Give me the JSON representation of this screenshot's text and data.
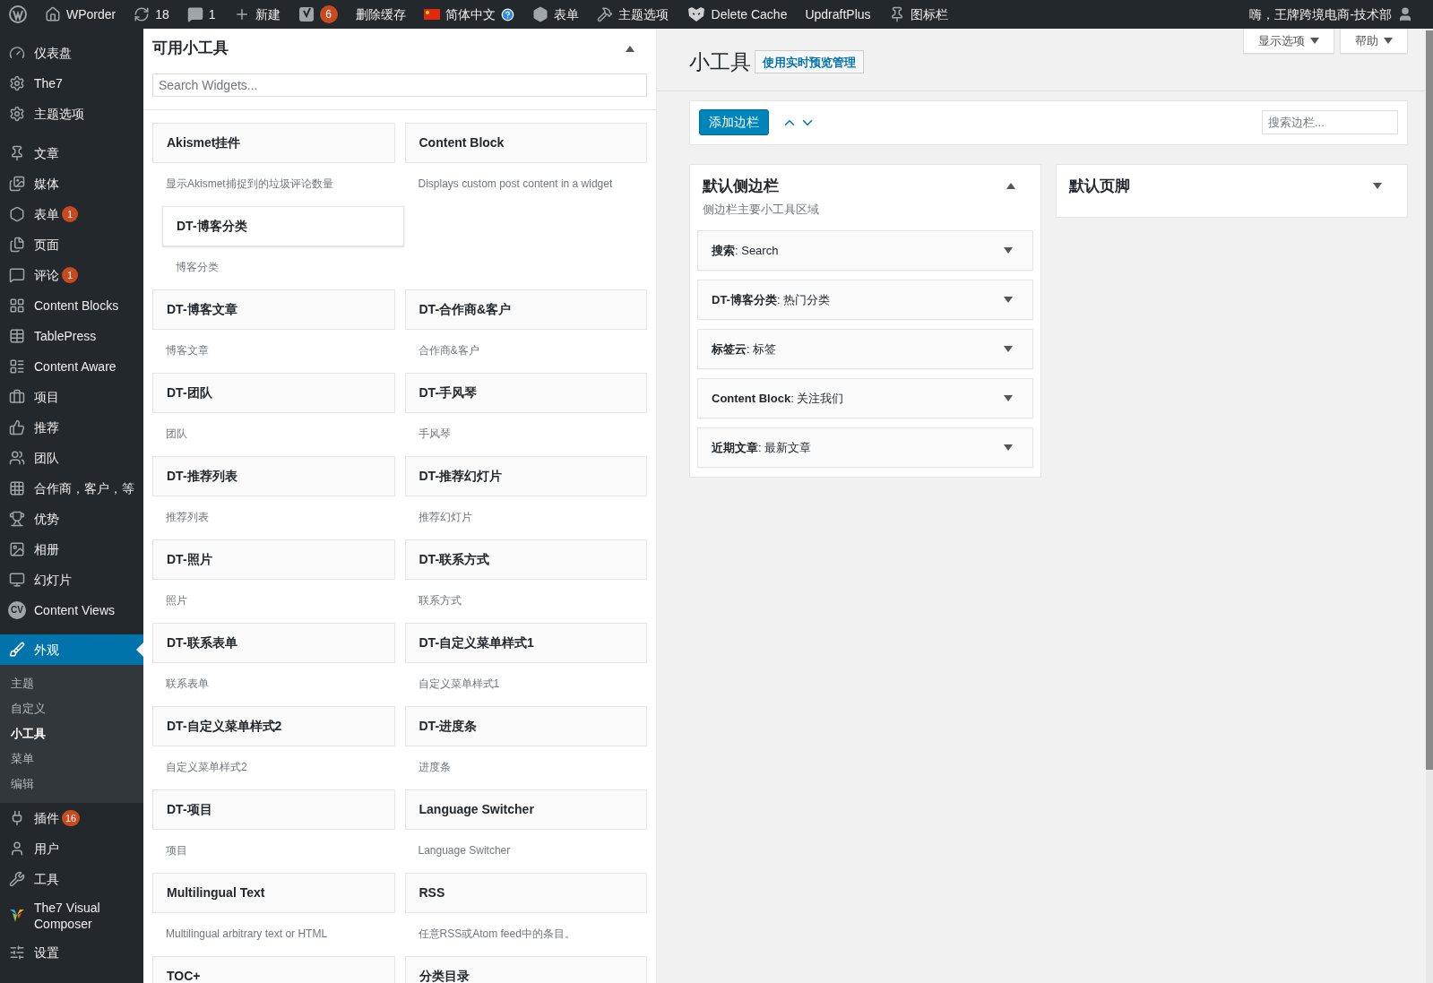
{
  "admin_bar": {
    "left": [
      {
        "label": "WPorder"
      },
      {
        "label": "18"
      },
      {
        "label": "1"
      },
      {
        "label": "新建"
      },
      {
        "badge": "6"
      },
      {
        "label": "删除缓存"
      },
      {
        "label": "简体中文"
      },
      {
        "label": "表单"
      },
      {
        "label": "主题选项"
      },
      {
        "label": "Delete Cache"
      },
      {
        "label": "UpdraftPlus"
      },
      {
        "label": "图标栏"
      }
    ],
    "greeting": "嗨，王牌跨境电商-技术部"
  },
  "sidebar": {
    "groups": [
      [
        {
          "label": "仪表盘",
          "selected": false
        },
        {
          "label": "The7",
          "selected": false
        },
        {
          "label": "主题选项",
          "selected": false
        }
      ],
      [
        {
          "label": "文章",
          "selected": false
        },
        {
          "label": "媒体",
          "selected": false
        },
        {
          "label": "表单",
          "badge": "1",
          "selected": false
        },
        {
          "label": "页面",
          "selected": false
        },
        {
          "label": "评论",
          "badge": "1",
          "selected": false
        },
        {
          "label": "Content Blocks",
          "selected": false
        },
        {
          "label": "TablePress",
          "selected": false
        },
        {
          "label": "Content Aware",
          "selected": false
        },
        {
          "label": "项目",
          "selected": false
        },
        {
          "label": "推荐",
          "selected": false
        },
        {
          "label": "团队",
          "selected": false
        },
        {
          "label": "合作商，客户，等",
          "selected": false
        },
        {
          "label": "优势",
          "selected": false
        },
        {
          "label": "相册",
          "selected": false
        },
        {
          "label": "幻灯片",
          "selected": false
        },
        {
          "label": "Content Views",
          "icon_text": "CV",
          "selected": false
        }
      ],
      [
        {
          "label": "外观",
          "selected": true,
          "children": [
            {
              "label": "主题",
              "selected": false
            },
            {
              "label": "自定义",
              "selected": false
            },
            {
              "label": "小工具",
              "selected": true
            },
            {
              "label": "菜单",
              "selected": false
            },
            {
              "label": "编辑",
              "selected": false
            }
          ]
        },
        {
          "label": "插件",
          "badge": "16",
          "selected": false
        },
        {
          "label": "用户",
          "selected": false
        },
        {
          "label": "工具",
          "selected": false
        },
        {
          "label": "The7 Visual Composer",
          "selected": false
        },
        {
          "label": "设置",
          "selected": false
        }
      ]
    ]
  },
  "available_widgets": {
    "title": "可用小工具",
    "expanded": true,
    "search": {
      "placeholder": "Search Widgets..."
    },
    "widgets": [
      {
        "name": "Akismet挂件",
        "description": "显示Akismet捕捉到的垃圾评论数量",
        "dragging": false
      },
      {
        "name": "Content Block",
        "description": "Displays custom post content in a widget",
        "dragging": false
      },
      {
        "name": "DT-博客分类",
        "description": "博客分类",
        "dragging": true
      },
      {
        "name": "DT-博客文章",
        "description": "博客文章",
        "dragging": false
      },
      {
        "name": "DT-合作商&客户",
        "description": "合作商&客户",
        "dragging": false
      },
      {
        "name": "DT-团队",
        "description": "团队",
        "dragging": false
      },
      {
        "name": "DT-手风琴",
        "description": "手风琴",
        "dragging": false
      },
      {
        "name": "DT-推荐列表",
        "description": "推荐列表",
        "dragging": false
      },
      {
        "name": "DT-推荐幻灯片",
        "description": "推荐幻灯片",
        "dragging": false
      },
      {
        "name": "DT-照片",
        "description": "照片",
        "dragging": false
      },
      {
        "name": "DT-联系方式",
        "description": "联系方式",
        "dragging": false
      },
      {
        "name": "DT-联系表单",
        "description": "联系表单",
        "dragging": false
      },
      {
        "name": "DT-自定义菜单样式1",
        "description": "自定义菜单样式1",
        "dragging": false
      },
      {
        "name": "DT-自定义菜单样式2",
        "description": "自定义菜单样式2",
        "dragging": false
      },
      {
        "name": "DT-进度条",
        "description": "进度条",
        "dragging": false
      },
      {
        "name": "DT-项目",
        "description": "项目",
        "dragging": false
      },
      {
        "name": "Language Switcher",
        "description": "Language Switcher",
        "dragging": false
      },
      {
        "name": "Multilingual Text",
        "description": "Multilingual arbitrary text or HTML",
        "dragging": false
      },
      {
        "name": "RSS",
        "description": "任意RSS或Atom feed中的条目。",
        "dragging": false
      },
      {
        "name": "TOC+",
        "dragging": false
      },
      {
        "name": "分类目录",
        "dragging": false
      }
    ]
  },
  "screen_options": [
    "显示选项",
    "帮助"
  ],
  "page_title": "小工具",
  "live_preview_button": "使用实时预览管理",
  "toolbar": {
    "add_button": "添加边栏",
    "search": {
      "placeholder": "搜索边栏..."
    }
  },
  "sidebars": [
    {
      "title": "默认侧边栏",
      "description": "侧边栏主要小工具区域",
      "expanded": true,
      "widgets": [
        "**搜索**: Search",
        "**DT-博客分类**: 热门分类",
        "**标签云**: 标签",
        "**Content Block**: 关注我们",
        "**近期文章**: 最新文章"
      ]
    },
    {
      "title": "默认页脚",
      "expanded": false
    }
  ]
}
